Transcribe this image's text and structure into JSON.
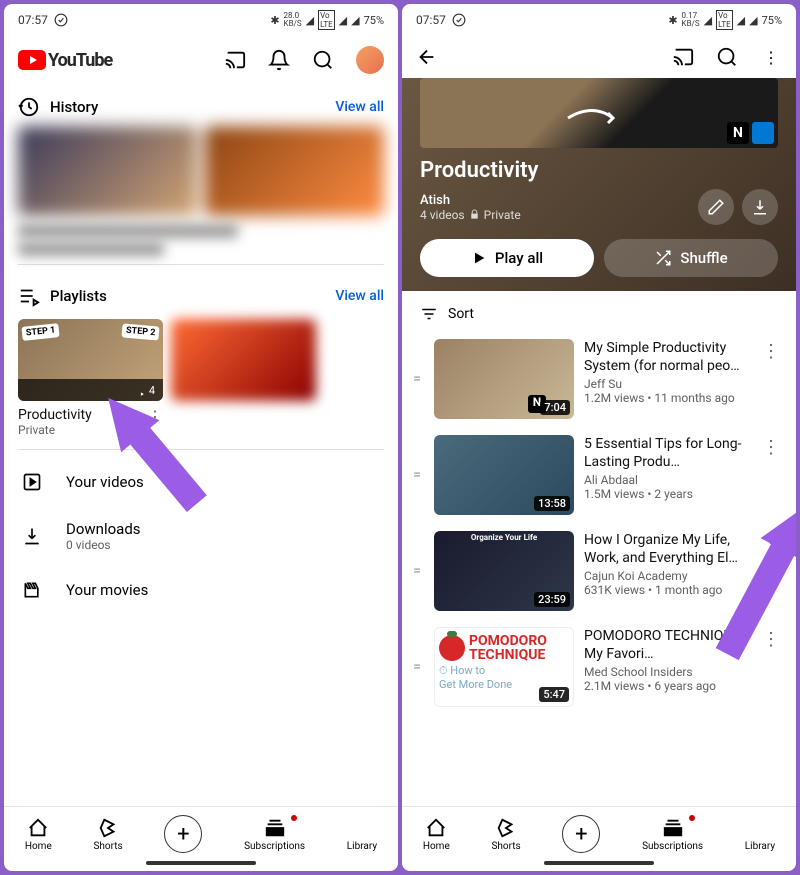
{
  "statusbar": {
    "time": "07:57",
    "net1": "28.0\nKB/S",
    "net2": "0.17\nKB/S",
    "battery": "75%"
  },
  "left": {
    "brand": "YouTube",
    "history_label": "History",
    "viewall": "View all",
    "playlists_label": "Playlists",
    "playlist": {
      "name": "Productivity",
      "privacy": "Private",
      "count": "4"
    },
    "your_videos": "Your videos",
    "downloads": "Downloads",
    "downloads_sub": "0 videos",
    "your_movies": "Your movies"
  },
  "right": {
    "title": "Productivity",
    "author": "Atish",
    "meta": "4 videos",
    "privacy": "Private",
    "playall": "Play all",
    "shuffle": "Shuffle",
    "sort": "Sort",
    "videos": [
      {
        "title": "My Simple Productivity System (for normal peo…",
        "channel": "Jeff Su",
        "stats": "1.2M views • 11 months ago",
        "duration": "7:04"
      },
      {
        "title": "5 Essential Tips for Long-Lasting Produ…",
        "channel": "Ali Abdaal",
        "stats": "1.5M views • 2 years",
        "duration": "13:58"
      },
      {
        "title": "How I Organize My Life, Work, and Everything El…",
        "channel": "Cajun Koi Academy",
        "stats": "631K views • 1 month ago",
        "duration": "23:59"
      },
      {
        "title": "POMODORO TECHNIQUE - My Favori…",
        "channel": "Med School Insiders",
        "stats": "2.1M views • 6 years ago",
        "duration": "5:47"
      }
    ]
  },
  "nav": {
    "home": "Home",
    "shorts": "Shorts",
    "subs": "Subscriptions",
    "library": "Library"
  }
}
